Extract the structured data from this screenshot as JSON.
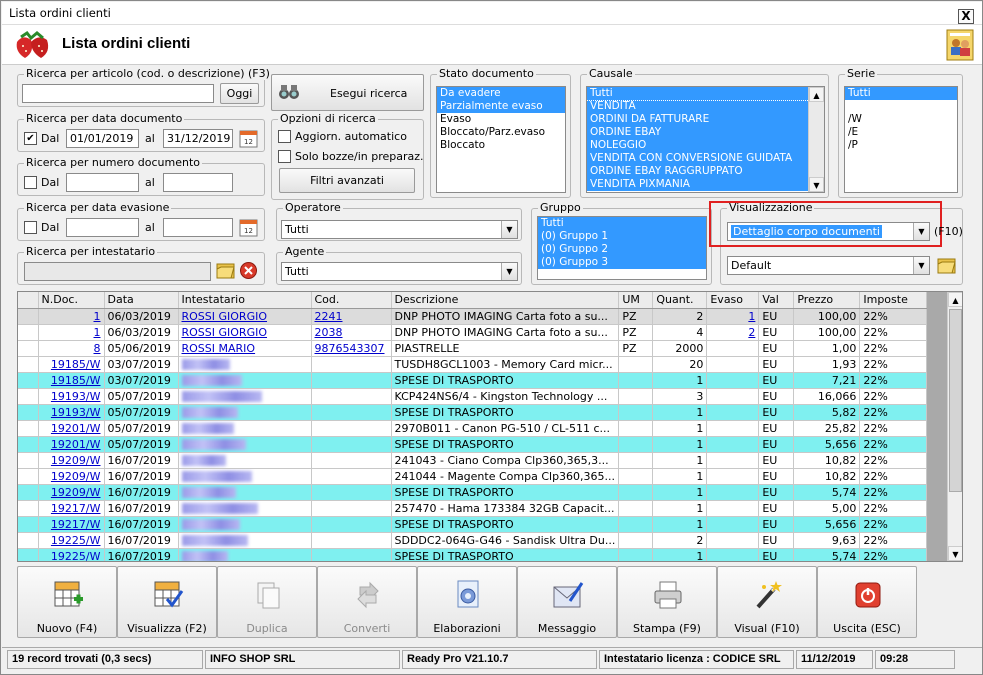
{
  "window": {
    "title": "Lista ordini clienti",
    "close": "X"
  },
  "header": {
    "title": "Lista ordini clienti"
  },
  "search_article": {
    "label": "Ricerca per articolo (cod. o descrizione) (F3)",
    "value": "",
    "today": "Oggi"
  },
  "search_btn": "Esegui ricerca",
  "search_date": {
    "label": "Ricerca per data documento",
    "from_label": "Dal",
    "from": "01/01/2019",
    "to_label": "al",
    "to": "31/12/2019"
  },
  "search_num": {
    "label": "Ricerca per numero documento",
    "from_label": "Dal",
    "to_label": "al"
  },
  "options": {
    "label": "Opzioni di ricerca",
    "auto": "Aggiorn. automatico",
    "drafts": "Solo bozze/in preparaz.",
    "advanced": "Filtri avanzati"
  },
  "stato": {
    "label": "Stato documento",
    "items": [
      {
        "t": "Da evadere",
        "s": true
      },
      {
        "t": "Parzialmente evaso",
        "s": true
      },
      {
        "t": "Evaso",
        "s": false
      },
      {
        "t": "Bloccato/Parz.evaso",
        "s": false
      },
      {
        "t": "Bloccato",
        "s": false
      }
    ]
  },
  "causale": {
    "label": "Causale",
    "items": [
      "Tutti",
      "VENDITA",
      "ORDINI DA FATTURARE",
      "ORDINE EBAY",
      "NOLEGGIO",
      "VENDITA CON CONVERSIONE GUIDATA",
      "ORDINE EBAY RAGGRUPPATO",
      "VENDITA PIXMANIA"
    ]
  },
  "serie": {
    "label": "Serie",
    "items": [
      {
        "t": "Tutti",
        "s": true
      },
      {
        "t": "",
        "s": false
      },
      {
        "t": "/W",
        "s": false
      },
      {
        "t": "/E",
        "s": false
      },
      {
        "t": "/P",
        "s": false
      }
    ]
  },
  "search_evas": {
    "label": "Ricerca per data evasione",
    "from_label": "Dal",
    "to_label": "al"
  },
  "search_owner": {
    "label": "Ricerca per intestatario"
  },
  "operatore": {
    "label": "Operatore",
    "value": "Tutti"
  },
  "agente": {
    "label": "Agente",
    "value": "Tutti"
  },
  "gruppo": {
    "label": "Gruppo",
    "items": [
      "Tutti",
      "(0) Gruppo 1",
      "(0) Gruppo 2",
      "(0) Gruppo 3"
    ]
  },
  "visualizzazione": {
    "label": "Visualizzazione",
    "value": "Dettaglio corpo documenti",
    "key": "(F10)",
    "layout": "Default"
  },
  "table": {
    "columns": [
      "N.Doc.",
      "Data",
      "Intestatario",
      "Cod.",
      "Descrizione",
      "UM",
      "Quant.",
      "Evaso",
      "Val",
      "Prezzo",
      "Imposte"
    ],
    "rows": [
      {
        "n": "1",
        "d": "06/03/2019",
        "i": "ROSSI GIORGIO",
        "c": "2241",
        "desc": "DNP PHOTO IMAGING Carta foto a su...",
        "um": "PZ",
        "q": "2",
        "e": "1",
        "v": "EU",
        "p": "100,00",
        "imp": "22%",
        "k": "g"
      },
      {
        "n": "1",
        "d": "06/03/2019",
        "i": "ROSSI GIORGIO",
        "c": "2038",
        "desc": "DNP PHOTO IMAGING Carta foto a su...",
        "um": "PZ",
        "q": "4",
        "e": "2",
        "v": "EU",
        "p": "100,00",
        "imp": "22%",
        "k": "w"
      },
      {
        "n": "8",
        "d": "05/06/2019",
        "i": "ROSSI MARIO",
        "c": "9876543307",
        "desc": "PIASTRELLE",
        "um": "PZ",
        "q": "2000",
        "e": "",
        "v": "EU",
        "p": "1,00",
        "imp": "22%",
        "k": "w"
      },
      {
        "n": "19185/W",
        "d": "03/07/2019",
        "i": "",
        "c": "",
        "desc": "TUSDH8GCL1003 - Memory Card micr...",
        "um": "",
        "q": "20",
        "e": "",
        "v": "EU",
        "p": "1,93",
        "imp": "22%",
        "k": "w"
      },
      {
        "n": "19185/W",
        "d": "03/07/2019",
        "i": "",
        "c": "",
        "desc": "SPESE DI TRASPORTO",
        "um": "",
        "q": "1",
        "e": "",
        "v": "EU",
        "p": "7,21",
        "imp": "22%",
        "k": "c"
      },
      {
        "n": "19193/W",
        "d": "05/07/2019",
        "i": "",
        "c": "",
        "desc": "KCP424NS6/4 - Kingston Technology ...",
        "um": "",
        "q": "3",
        "e": "",
        "v": "EU",
        "p": "16,066",
        "imp": "22%",
        "k": "w"
      },
      {
        "n": "19193/W",
        "d": "05/07/2019",
        "i": "",
        "c": "",
        "desc": "SPESE DI TRASPORTO",
        "um": "",
        "q": "1",
        "e": "",
        "v": "EU",
        "p": "5,82",
        "imp": "22%",
        "k": "c"
      },
      {
        "n": "19201/W",
        "d": "05/07/2019",
        "i": "",
        "c": "",
        "desc": "2970B011 - Canon PG-510 / CL-511 c...",
        "um": "",
        "q": "1",
        "e": "",
        "v": "EU",
        "p": "25,82",
        "imp": "22%",
        "k": "w"
      },
      {
        "n": "19201/W",
        "d": "05/07/2019",
        "i": "",
        "c": "",
        "desc": "SPESE DI TRASPORTO",
        "um": "",
        "q": "1",
        "e": "",
        "v": "EU",
        "p": "5,656",
        "imp": "22%",
        "k": "c"
      },
      {
        "n": "19209/W",
        "d": "16/07/2019",
        "i": "",
        "c": "",
        "desc": "241043 - Ciano Compa Clp360,365,3...",
        "um": "",
        "q": "1",
        "e": "",
        "v": "EU",
        "p": "10,82",
        "imp": "22%",
        "k": "w"
      },
      {
        "n": "19209/W",
        "d": "16/07/2019",
        "i": "",
        "c": "",
        "desc": "241044 - Magente Compa Clp360,365...",
        "um": "",
        "q": "1",
        "e": "",
        "v": "EU",
        "p": "10,82",
        "imp": "22%",
        "k": "w"
      },
      {
        "n": "19209/W",
        "d": "16/07/2019",
        "i": "",
        "c": "",
        "desc": "SPESE DI TRASPORTO",
        "um": "",
        "q": "1",
        "e": "",
        "v": "EU",
        "p": "5,74",
        "imp": "22%",
        "k": "c"
      },
      {
        "n": "19217/W",
        "d": "16/07/2019",
        "i": "",
        "c": "",
        "desc": "257470 - Hama 173384 32GB Capacit...",
        "um": "",
        "q": "1",
        "e": "",
        "v": "EU",
        "p": "5,00",
        "imp": "22%",
        "k": "w"
      },
      {
        "n": "19217/W",
        "d": "16/07/2019",
        "i": "",
        "c": "",
        "desc": "SPESE DI TRASPORTO",
        "um": "",
        "q": "1",
        "e": "",
        "v": "EU",
        "p": "5,656",
        "imp": "22%",
        "k": "c"
      },
      {
        "n": "19225/W",
        "d": "16/07/2019",
        "i": "",
        "c": "",
        "desc": "SDDDC2-064G-G46 - Sandisk Ultra Du...",
        "um": "",
        "q": "2",
        "e": "",
        "v": "EU",
        "p": "9,63",
        "imp": "22%",
        "k": "w"
      },
      {
        "n": "19225/W",
        "d": "16/07/2019",
        "i": "",
        "c": "",
        "desc": "SPESE DI TRASPORTO",
        "um": "",
        "q": "1",
        "e": "",
        "v": "EU",
        "p": "5,74",
        "imp": "22%",
        "k": "c"
      }
    ]
  },
  "toolbar": [
    {
      "label": "Nuovo (F4)",
      "icon": "new-grid-icon",
      "dis": false
    },
    {
      "label": "Visualizza (F2)",
      "icon": "view-grid-icon",
      "dis": false
    },
    {
      "label": "Duplica",
      "icon": "duplicate-icon",
      "dis": true
    },
    {
      "label": "Converti",
      "icon": "convert-icon",
      "dis": true
    },
    {
      "label": "Elaborazioni",
      "icon": "processing-icon",
      "dis": false
    },
    {
      "label": "Messaggio",
      "icon": "message-icon",
      "dis": false
    },
    {
      "label": "Stampa (F9)",
      "icon": "printer-icon",
      "dis": false
    },
    {
      "label": "Visual (F10)",
      "icon": "magic-wand-icon",
      "dis": false
    },
    {
      "label": "Uscita (ESC)",
      "icon": "exit-icon",
      "dis": false
    }
  ],
  "status": {
    "records": "19 record trovati (0,3 secs)",
    "company": "INFO SHOP SRL",
    "version": "Ready Pro V21.10.7",
    "license": "Intestatario licenza : CODICE SRL",
    "date": "11/12/2019",
    "time": "09:28"
  },
  "colors": {
    "selection": "#3399ff",
    "cyan_row": "#7ff0f0",
    "highlight": "#e02020"
  }
}
